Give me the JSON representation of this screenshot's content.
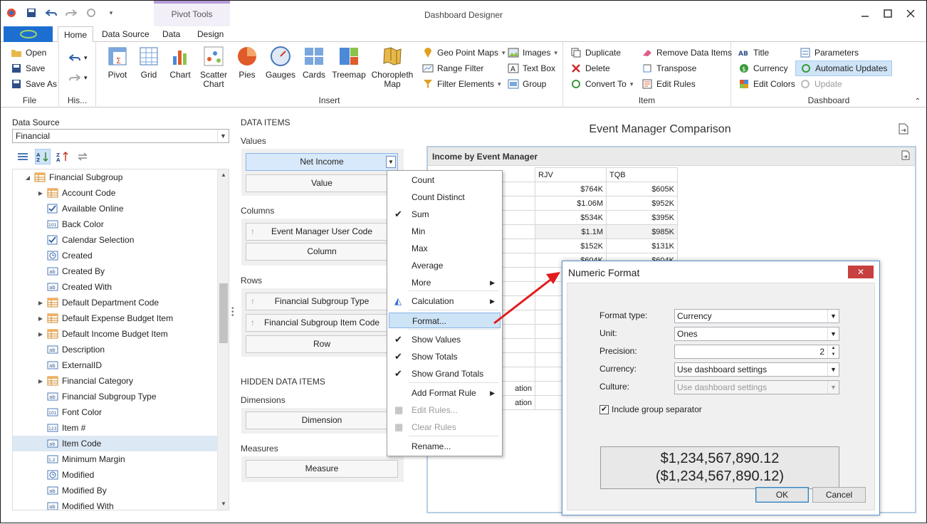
{
  "window": {
    "title": "Dashboard Designer",
    "context_tab_group": "Pivot Tools"
  },
  "ribbon_tabs": [
    "Home",
    "Data Source",
    "Data",
    "Design"
  ],
  "ribbon": {
    "file": {
      "label": "File",
      "open": "Open",
      "save": "Save",
      "save_as": "Save As"
    },
    "history": {
      "label": "His..."
    },
    "insert": {
      "label": "Insert",
      "pivot": "Pivot",
      "grid": "Grid",
      "chart": "Chart",
      "scatter": "Scatter Chart",
      "pies": "Pies",
      "gauges": "Gauges",
      "cards": "Cards",
      "treemap": "Treemap",
      "choropleth": "Choropleth Map",
      "geo_point_maps": "Geo Point Maps",
      "range_filter": "Range Filter",
      "filter_elements": "Filter Elements",
      "images": "Images",
      "text_box": "Text Box",
      "group": "Group"
    },
    "item": {
      "label": "Item",
      "duplicate": "Duplicate",
      "delete": "Delete",
      "convert_to": "Convert To",
      "remove_data_items": "Remove Data Items",
      "transpose": "Transpose",
      "edit_rules": "Edit Rules"
    },
    "dashboard": {
      "label": "Dashboard",
      "title": "Title",
      "currency": "Currency",
      "edit_colors": "Edit Colors",
      "parameters": "Parameters",
      "automatic_updates": "Automatic Updates",
      "update": "Update"
    }
  },
  "data_source": {
    "label": "Data Source",
    "selected": "Financial"
  },
  "tree": [
    {
      "label": "Financial Subgroup",
      "type": "table",
      "level": 0,
      "expanded": true
    },
    {
      "label": "Account Code",
      "type": "table",
      "level": 1,
      "expandable": true
    },
    {
      "label": "Available Online",
      "type": "bool",
      "level": 1
    },
    {
      "label": "Back Color",
      "type": "num",
      "level": 1
    },
    {
      "label": "Calendar Selection",
      "type": "bool",
      "level": 1
    },
    {
      "label": "Created",
      "type": "date",
      "level": 1
    },
    {
      "label": "Created By",
      "type": "text",
      "level": 1
    },
    {
      "label": "Created With",
      "type": "text",
      "level": 1
    },
    {
      "label": "Default Department Code",
      "type": "table",
      "level": 1,
      "expandable": true
    },
    {
      "label": "Default Expense Budget Item",
      "type": "table",
      "level": 1,
      "expandable": true
    },
    {
      "label": "Default Income Budget Item",
      "type": "table",
      "level": 1,
      "expandable": true
    },
    {
      "label": "Description",
      "type": "text",
      "level": 1
    },
    {
      "label": "ExternalID",
      "type": "text",
      "level": 1
    },
    {
      "label": "Financial Category",
      "type": "table",
      "level": 1,
      "expandable": true
    },
    {
      "label": "Financial Subgroup Type",
      "type": "text",
      "level": 1
    },
    {
      "label": "Font Color",
      "type": "num",
      "level": 1
    },
    {
      "label": "Item #",
      "type": "int",
      "level": 1
    },
    {
      "label": "Item Code",
      "type": "text",
      "level": 1,
      "selected": true
    },
    {
      "label": "Minimum Margin",
      "type": "dec",
      "level": 1
    },
    {
      "label": "Modified",
      "type": "date",
      "level": 1
    },
    {
      "label": "Modified By",
      "type": "text",
      "level": 1
    },
    {
      "label": "Modified With",
      "type": "text",
      "level": 1
    }
  ],
  "data_items": {
    "header": "DATA ITEMS",
    "values_label": "Values",
    "values_item": "Net Income",
    "values_placeholder": "Value",
    "columns_label": "Columns",
    "columns_item": "Event Manager User Code",
    "columns_placeholder": "Column",
    "rows_label": "Rows",
    "rows_item1": "Financial Subgroup Type",
    "rows_item2": "Financial Subgroup Item Code",
    "rows_placeholder": "Row",
    "hidden_header": "HIDDEN DATA ITEMS",
    "dimensions_label": "Dimensions",
    "dimensions_placeholder": "Dimension",
    "measures_label": "Measures",
    "measures_placeholder": "Measure"
  },
  "dashboard": {
    "title": "Event Manager Comparison",
    "pivot_title": "Income by Event Manager",
    "columns": [
      "RJV",
      "TQB"
    ],
    "rows": [
      [
        "$764K",
        "$605K"
      ],
      [
        "$1.06M",
        "$952K"
      ],
      [
        "$534K",
        "$395K"
      ],
      [
        "$1.1M",
        "$985K"
      ],
      [
        "$152K",
        "$131K"
      ],
      [
        "$604K",
        "$604K"
      ]
    ],
    "row_fragments": [
      "ation",
      "ation"
    ]
  },
  "context_menu": {
    "items": [
      {
        "label": "Count"
      },
      {
        "label": "Count Distinct"
      },
      {
        "label": "Sum",
        "checked": true
      },
      {
        "label": "Min"
      },
      {
        "label": "Max"
      },
      {
        "label": "Average"
      },
      {
        "label": "More",
        "submenu": true
      },
      {
        "label": "Calculation",
        "submenu": true
      },
      {
        "label": "Format...",
        "highlight": true
      },
      {
        "label": "Show Values",
        "checked": true
      },
      {
        "label": "Show Totals",
        "checked": true
      },
      {
        "label": "Show Grand Totals",
        "checked": true
      },
      {
        "label": "Add Format Rule",
        "submenu": true
      },
      {
        "label": "Edit Rules...",
        "disabled": true
      },
      {
        "label": "Clear Rules",
        "disabled": true
      },
      {
        "label": "Rename..."
      }
    ]
  },
  "dialog": {
    "title": "Numeric Format",
    "format_type_label": "Format type:",
    "format_type": "Currency",
    "unit_label": "Unit:",
    "unit": "Ones",
    "precision_label": "Precision:",
    "precision": "2",
    "currency_label": "Currency:",
    "currency": "Use dashboard settings",
    "culture_label": "Culture:",
    "culture": "Use dashboard settings",
    "group_separator": "Include group separator",
    "preview_line1": "$1,234,567,890.12",
    "preview_line2": "($1,234,567,890.12)",
    "ok": "OK",
    "cancel": "Cancel"
  },
  "colors": {
    "accent": "#1c6fd1",
    "arrow": "#e21b1b",
    "selection": "#cde4f7"
  }
}
